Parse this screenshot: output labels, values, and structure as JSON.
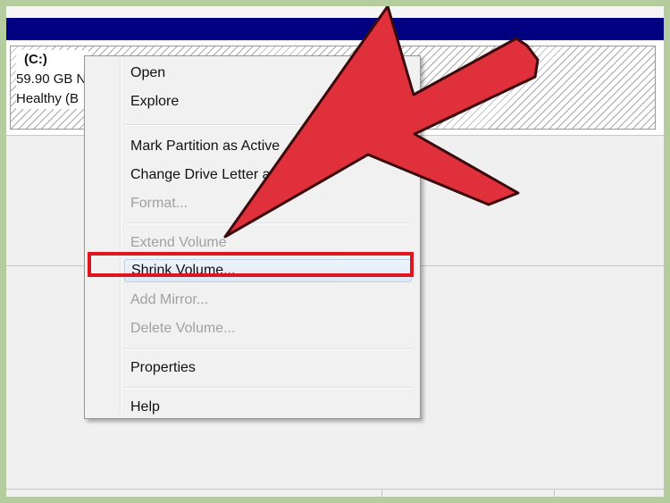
{
  "volume": {
    "name": "(C:)",
    "size": "59.90 GB N",
    "status": "Healthy (B"
  },
  "context_menu": {
    "items": [
      {
        "label": "Open",
        "enabled": true
      },
      {
        "label": "Explore",
        "enabled": true
      },
      {
        "label": "Mark Partition as Active",
        "enabled": true
      },
      {
        "label": "Change Drive Letter a",
        "enabled": true
      },
      {
        "label": "Format...",
        "enabled": false
      },
      {
        "label": "Extend Volume",
        "enabled": false
      },
      {
        "label": "Shrink Volume...",
        "enabled": true,
        "highlighted": true
      },
      {
        "label": "Add Mirror...",
        "enabled": false
      },
      {
        "label": "Delete Volume...",
        "enabled": false
      },
      {
        "label": "Properties",
        "enabled": true
      },
      {
        "label": "Help",
        "enabled": true
      }
    ]
  },
  "annotation": {
    "arrow_color": "#e0303c",
    "highlight_color": "#e0161e"
  },
  "colors": {
    "background": "#b5cc9e",
    "title_bar": "#000080"
  }
}
